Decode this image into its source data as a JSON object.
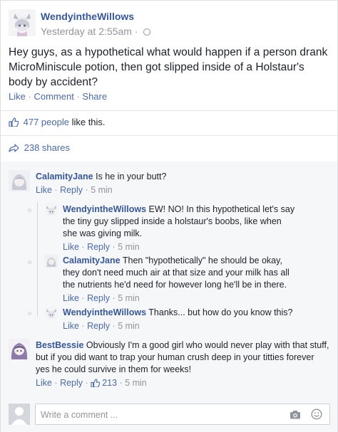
{
  "post": {
    "author": "WendyintheWillows",
    "time": "Yesterday at 2:55am",
    "separator": "·",
    "text": "Hey guys, as a hypothetical what would happen if a person drank MicroMiniscule potion, then got slipped inside of a Holstaur's body by accident?",
    "actions": {
      "like": "Like",
      "comment": "Comment",
      "share": "Share",
      "dot": "·"
    }
  },
  "likes": {
    "count_text": "477 people",
    "suffix": " like this."
  },
  "shares": {
    "text": "238 shares"
  },
  "comments": [
    {
      "author": "CalamityJane",
      "text": "Is he in your butt?",
      "like": "Like",
      "reply": "Reply",
      "time": "5 min",
      "replies": [
        {
          "author": "WendyintheWillows",
          "text": "EW! NO! In this hypothetical let's say the tiny guy slipped inside a holstaur's boobs, like when she was giving milk.",
          "like": "Like",
          "reply": "Reply",
          "time": "5 min"
        },
        {
          "author": "CalamityJane",
          "text": "Then \"hypothetically\" he should be okay, they don't need much air at that size and your milk has all the nutrients he'd need for however long he'll be in there.",
          "like": "Like",
          "reply": "Reply",
          "time": "5 min"
        },
        {
          "author": "WendyintheWillows",
          "text": "Thanks... but how do you know this?",
          "like": "Like",
          "reply": "Reply",
          "time": "5 min"
        }
      ]
    },
    {
      "author": "BestBessie",
      "text": "Obviously I'm a good girl who would never play with that stuff, but if you did want to trap your human crush deep in your titties forever yes he could survive in them for weeks!",
      "like": "Like",
      "reply": "Reply",
      "likes": "213",
      "time": "5 min"
    }
  ],
  "composer": {
    "placeholder": "Write a comment ..."
  },
  "icons": {
    "globe": "globe-icon",
    "thumbs_up": "thumbs-up-icon",
    "share": "share-arrow-icon",
    "camera": "camera-icon",
    "smiley": "smiley-icon"
  },
  "colors": {
    "link": "#365899",
    "muted": "#90949c",
    "action": "#4b6aa5",
    "bg": "#f6f7f9"
  }
}
